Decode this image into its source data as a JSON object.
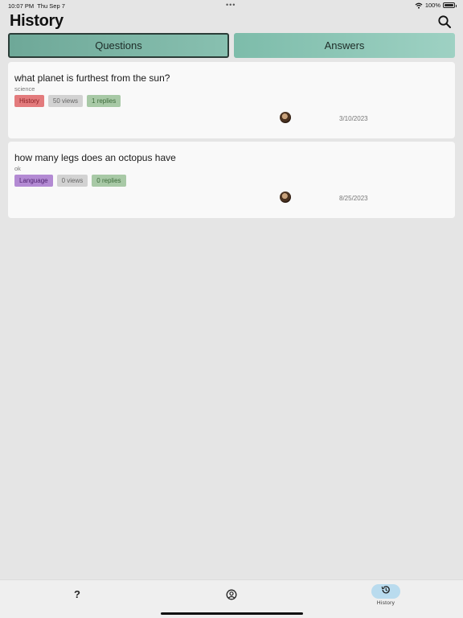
{
  "status_bar": {
    "time": "10:07 PM",
    "date": "Thu Sep 7",
    "dots": "•••",
    "battery": "100%",
    "icons": [
      "wifi-icon",
      "battery-icon"
    ]
  },
  "header": {
    "title": "History",
    "search_icon": "search-icon"
  },
  "tabs": [
    {
      "label": "Questions",
      "selected": true
    },
    {
      "label": "Answers",
      "selected": false
    }
  ],
  "questions": [
    {
      "title": "what planet is furthest from the sun?",
      "category": "science",
      "subject": "History",
      "subject_color": "#e37b7d",
      "views": "50 views",
      "replies": "1 replies",
      "date": "3/10/2023"
    },
    {
      "title": "how many legs does an octopus have",
      "category": "ok",
      "subject": "Language",
      "subject_color": "#b38ad3",
      "views": "0 views",
      "replies": "0 replies",
      "date": "8/25/2023"
    }
  ],
  "bottom_nav": {
    "items": [
      {
        "icon": "question-mark-icon",
        "glyph": "?",
        "active": false
      },
      {
        "icon": "profile-icon",
        "active": false
      },
      {
        "icon": "history-icon",
        "label": "History",
        "active": true
      }
    ],
    "active_color": "#b9dbee"
  },
  "colors": {
    "background": "#e5e5e5",
    "card": "#f9f9f9",
    "tab_accent": "#7dbcaa"
  }
}
